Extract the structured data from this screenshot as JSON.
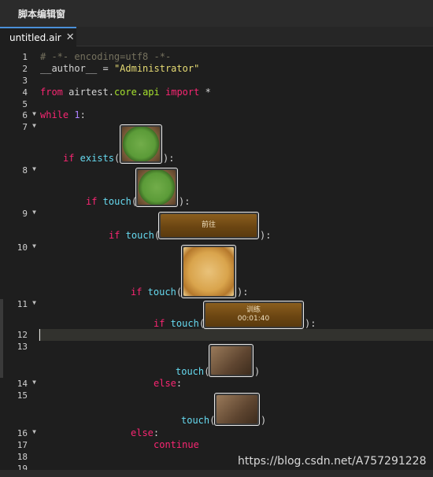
{
  "window": {
    "title": "脚本编辑窗"
  },
  "tab": {
    "label": "untitled.air",
    "close": "✕"
  },
  "lines": {
    "l1": {
      "num": "1",
      "text": "# -*- encoding=utf8 -*-"
    },
    "l2": {
      "num": "2",
      "var": "__author__",
      "op": " = ",
      "str": "\"Administrator\""
    },
    "l3": {
      "num": "3"
    },
    "l4": {
      "num": "4",
      "from": "from",
      "mod_a": " airtest.",
      "mod_b": "core",
      "mod_c": ".",
      "mod_d": "api",
      "import": " import",
      "star": " *"
    },
    "l5": {
      "num": "5"
    },
    "l6": {
      "num": "6",
      "kw": "while",
      "sp": " ",
      "val": "1",
      "colon": ":"
    },
    "l7": {
      "num": "7",
      "kw": "if",
      "fn": " exists",
      "open": "(",
      "close": "):"
    },
    "l8": {
      "num": "8",
      "kw": "if",
      "fn": " touch",
      "open": "(",
      "close": "):"
    },
    "l9": {
      "num": "9",
      "kw": "if",
      "fn": " touch",
      "open": "(",
      "close": "):",
      "button_text": "前往"
    },
    "l10": {
      "num": "10",
      "kw": "if",
      "fn": " touch",
      "open": "(",
      "close": "):"
    },
    "l11": {
      "num": "11",
      "kw": "if",
      "fn": " touch",
      "open": "(",
      "close": "):",
      "button_text": "训练",
      "button_time": "00:01:40"
    },
    "l12": {
      "num": "12"
    },
    "l13": {
      "num": "13",
      "fn": "touch",
      "open": "(",
      "close": ")"
    },
    "l14": {
      "num": "14",
      "kw": "else",
      "colon": ":"
    },
    "l15": {
      "num": "15",
      "fn": "touch",
      "open": "(",
      "close": ")"
    },
    "l16": {
      "num": "16",
      "kw": "else",
      "colon": ":"
    },
    "l17": {
      "num": "17",
      "kw": "continue"
    },
    "l18": {
      "num": "18"
    },
    "l19": {
      "num": "19"
    }
  },
  "watermark": "https://blog.csdn.net/A757291228",
  "colors": {
    "keyword": "#f92672",
    "function": "#66d9ef",
    "string": "#e6db74",
    "number": "#ae81ff",
    "comment": "#75715e"
  }
}
